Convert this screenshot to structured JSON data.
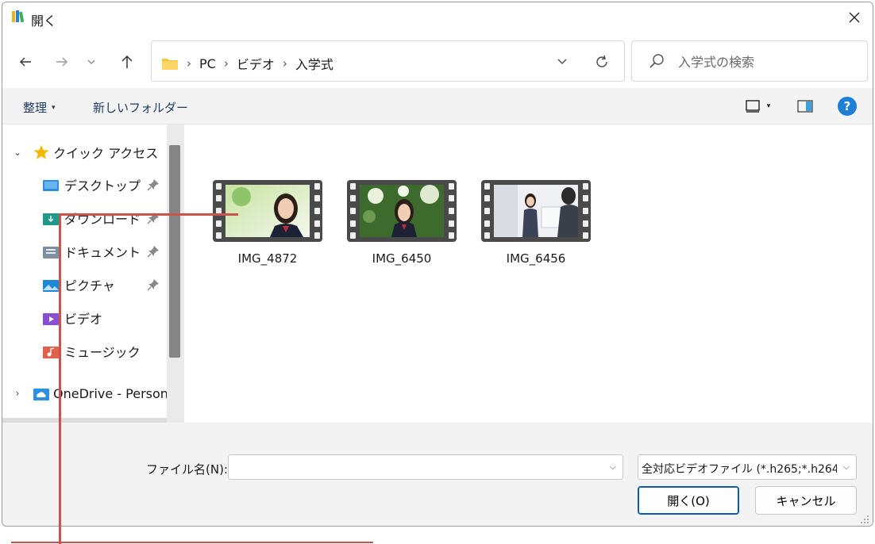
{
  "window": {
    "title": "開く"
  },
  "navigation": {
    "path": [
      "PC",
      "ビデオ",
      "入学式"
    ],
    "search_placeholder": "入学式の検索"
  },
  "toolbar": {
    "organize": "整理",
    "new_folder": "新しいフォルダー",
    "help": "?"
  },
  "sidebar": {
    "quick_access": "クイック アクセス",
    "items": [
      {
        "label": "デスクトップ",
        "icon": "desktop-folder-icon",
        "pinned": true
      },
      {
        "label": "ダウンロード",
        "icon": "downloads-folder-icon",
        "pinned": true
      },
      {
        "label": "ドキュメント",
        "icon": "documents-folder-icon",
        "pinned": true
      },
      {
        "label": "ピクチャ",
        "icon": "pictures-folder-icon",
        "pinned": true
      },
      {
        "label": "ビデオ",
        "icon": "videos-folder-icon",
        "pinned": false
      },
      {
        "label": "ミュージック",
        "icon": "music-folder-icon",
        "pinned": false
      }
    ],
    "onedrive": "OneDrive - Person"
  },
  "files": [
    {
      "name": "IMG_4872"
    },
    {
      "name": "IMG_6450"
    },
    {
      "name": "IMG_6456"
    }
  ],
  "footer": {
    "filename_label": "ファイル名(N):",
    "filename_value": "",
    "filetype_value": "全対応ビデオファイル (*.h265;*.h264",
    "open_button": "開く(O)",
    "cancel_button": "キャンセル"
  },
  "colors": {
    "accent": "#0b5cad",
    "annotation": "#c9544b",
    "help": "#1e7fd6"
  }
}
